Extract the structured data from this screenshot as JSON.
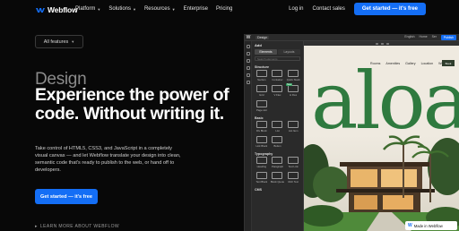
{
  "nav": {
    "brand": "Webflow",
    "links": [
      {
        "label": "Platform",
        "has_caret": true
      },
      {
        "label": "Solutions",
        "has_caret": true
      },
      {
        "label": "Resources",
        "has_caret": true
      },
      {
        "label": "Enterprise",
        "has_caret": false
      },
      {
        "label": "Pricing",
        "has_caret": false
      }
    ],
    "login": "Log in",
    "contact": "Contact sales",
    "cta": "Get started — it's free"
  },
  "hero": {
    "features_button": "All features",
    "eyebrow": "Design",
    "headline": "Experience the power of code. Without writing it.",
    "description": "Take control of HTML5, CSS3, and JavaScript in a completely visual canvas — and let Webflow translate your design into clean, semantic code that's ready to publish to the web, or hand off to developers.",
    "cta": "Get started — it's free",
    "learn_more": "LEARN MORE ABOUT WEBFLOW"
  },
  "designer": {
    "topbar": {
      "mode": "Design",
      "items": [
        "English",
        "Home",
        "Ser"
      ],
      "publish": "Publish"
    },
    "panel": {
      "title": "Add",
      "tabs": [
        {
          "label": "Elements",
          "active": true
        },
        {
          "label": "Layouts",
          "active": false
        }
      ],
      "search_placeholder": "Search elements",
      "sections": [
        {
          "name": "Structure",
          "items": [
            "Section",
            "Container",
            "Quick Stack",
            "Grid",
            "V Flex",
            "H Flex",
            "Page slot"
          ]
        },
        {
          "name": "Basic",
          "items": [
            "Div Block",
            "List",
            "List Item",
            "Link Block",
            "Button"
          ]
        },
        {
          "name": "Typography",
          "items": [
            "Heading",
            "Paragraph",
            "Text Link",
            "Text Block",
            "Block Quote",
            "Rich Text"
          ]
        },
        {
          "name": "CMS",
          "items": []
        }
      ],
      "new_badge": "New"
    },
    "site": {
      "nav": [
        "Rooms",
        "Amenities",
        "Gallery",
        "Location",
        "Weddings"
      ],
      "cta": "Book",
      "word": "aloa"
    }
  },
  "badge": {
    "label": "Made in Webflow"
  },
  "colors": {
    "accent": "#146ef5",
    "background": "#080808",
    "site_green": "#2f7a3f"
  }
}
